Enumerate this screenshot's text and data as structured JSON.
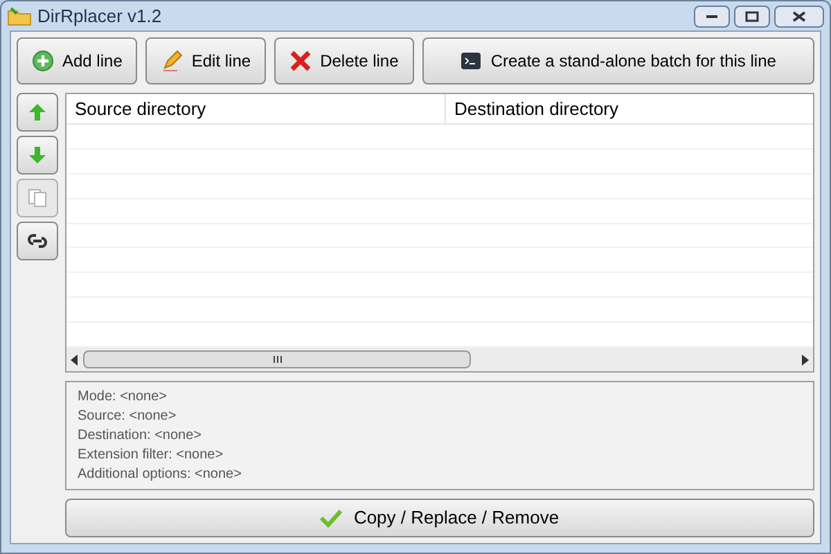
{
  "window": {
    "title": "DirRplacer v1.2"
  },
  "toolbar": [
    {
      "kind": "add",
      "label": "Add line"
    },
    {
      "kind": "edit",
      "label": "Edit line"
    },
    {
      "kind": "delete",
      "label": "Delete line"
    },
    {
      "kind": "batch",
      "label": "Create a stand-alone batch for this line"
    }
  ],
  "side_buttons": [
    {
      "kind": "up",
      "disabled": false
    },
    {
      "kind": "down",
      "disabled": false
    },
    {
      "kind": "copy",
      "disabled": true
    },
    {
      "kind": "link",
      "disabled": false
    }
  ],
  "table": {
    "columns": [
      "Source directory",
      "Destination directory"
    ]
  },
  "info": [
    "Mode: <none>",
    "Source: <none>",
    "Destination: <none>",
    "Extension filter: <none>",
    "Additional options: <none>"
  ],
  "run_button": {
    "label": "Copy / Replace / Remove"
  }
}
